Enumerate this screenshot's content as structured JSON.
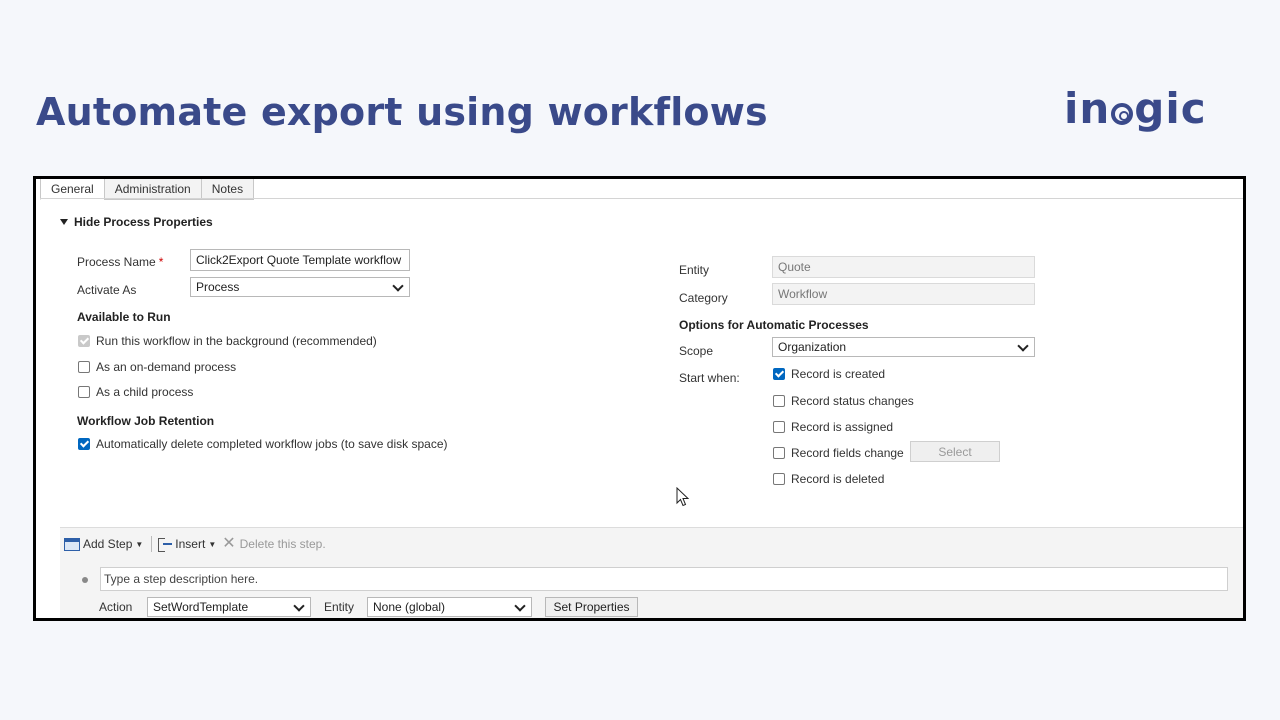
{
  "slide": {
    "title": "Automate export using workflows",
    "logo": "inogic"
  },
  "tabs": [
    "General",
    "Administration",
    "Notes"
  ],
  "section": {
    "title": "Hide Process Properties"
  },
  "left": {
    "process_name_label": "Process Name",
    "required_mark": "*",
    "process_name_value": "Click2Export Quote Template workflow",
    "activate_as_label": "Activate As",
    "activate_as_value": "Process",
    "available_heading": "Available to Run",
    "opt_background": "Run this workflow in the background (recommended)",
    "opt_ondemand": "As an on-demand process",
    "opt_child": "As a child process",
    "retention_heading": "Workflow Job Retention",
    "opt_autodelete": "Automatically delete completed workflow jobs (to save disk space)"
  },
  "right": {
    "entity_label": "Entity",
    "entity_value": "Quote",
    "category_label": "Category",
    "category_value": "Workflow",
    "options_heading": "Options for Automatic Processes",
    "scope_label": "Scope",
    "scope_value": "Organization",
    "start_when_label": "Start when:",
    "start_created": "Record is created",
    "start_status": "Record status changes",
    "start_assigned": "Record is assigned",
    "start_fields": "Record fields change",
    "start_deleted": "Record is deleted",
    "select_button": "Select"
  },
  "steps": {
    "add_step": "Add Step",
    "insert": "Insert",
    "delete_step": "Delete this step.",
    "description": "Type a step description here.",
    "action_label": "Action",
    "action_value": "SetWordTemplate",
    "entity_label": "Entity",
    "entity_value": "None (global)",
    "set_properties": "Set Properties"
  }
}
